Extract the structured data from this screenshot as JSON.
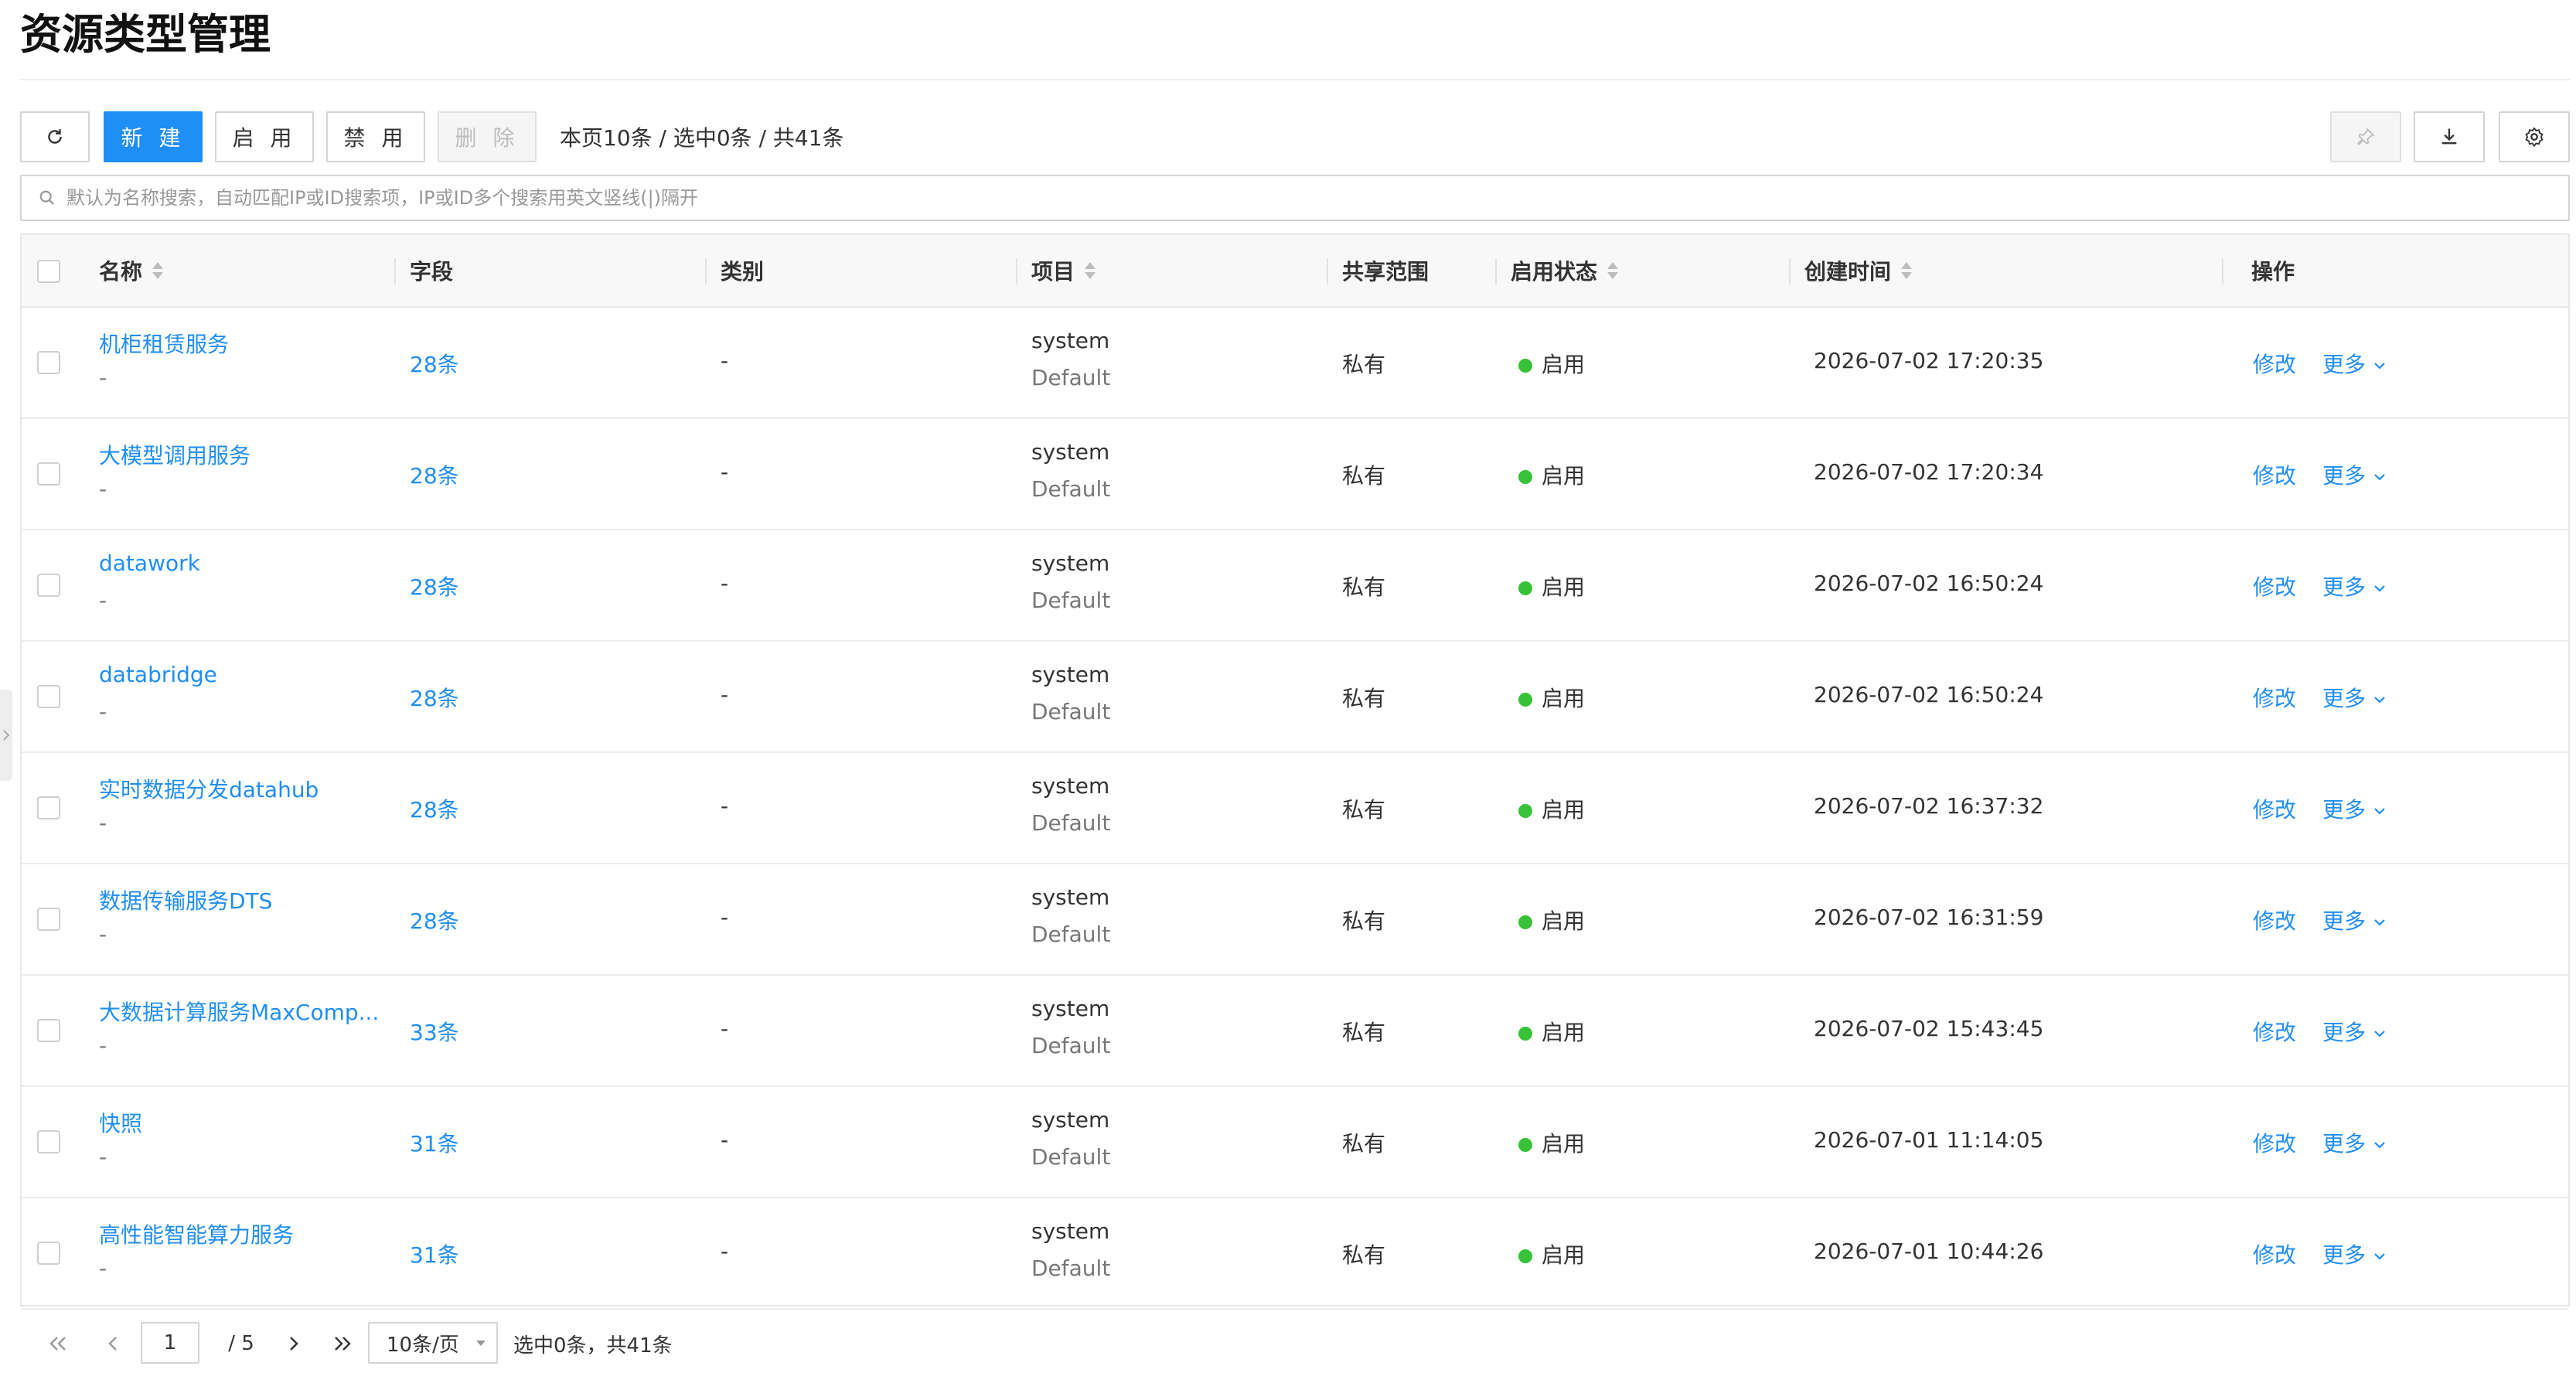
{
  "page": {
    "title": "资源类型管理"
  },
  "toolbar": {
    "new_label": "新 建",
    "enable_label": "启 用",
    "disable_label": "禁 用",
    "delete_label": "删 除",
    "summary": "本页10条 / 选中0条 / 共41条"
  },
  "search": {
    "placeholder": "默认为名称搜索，自动匹配IP或ID搜索项，IP或ID多个搜索用英文竖线(|)隔开",
    "value": ""
  },
  "table": {
    "headers": {
      "name": "名称",
      "fields": "字段",
      "category": "类别",
      "project": "项目",
      "share": "共享范围",
      "status": "启用状态",
      "created": "创建时间",
      "ops": "操作"
    },
    "rows": [
      {
        "name": "机柜租赁服务",
        "name_sub": "-",
        "fields": "28条",
        "category": "-",
        "project": "system",
        "project_sub": "Default",
        "share": "私有",
        "status": "启用",
        "created": "2026-07-02 17:20:35",
        "edit": "修改",
        "more": "更多"
      },
      {
        "name": "大模型调用服务",
        "name_sub": "-",
        "fields": "28条",
        "category": "-",
        "project": "system",
        "project_sub": "Default",
        "share": "私有",
        "status": "启用",
        "created": "2026-07-02 17:20:34",
        "edit": "修改",
        "more": "更多"
      },
      {
        "name": "datawork",
        "name_sub": "-",
        "fields": "28条",
        "category": "-",
        "project": "system",
        "project_sub": "Default",
        "share": "私有",
        "status": "启用",
        "created": "2026-07-02 16:50:24",
        "edit": "修改",
        "more": "更多"
      },
      {
        "name": "databridge",
        "name_sub": "-",
        "fields": "28条",
        "category": "-",
        "project": "system",
        "project_sub": "Default",
        "share": "私有",
        "status": "启用",
        "created": "2026-07-02 16:50:24",
        "edit": "修改",
        "more": "更多"
      },
      {
        "name": "实时数据分发datahub",
        "name_sub": "-",
        "fields": "28条",
        "category": "-",
        "project": "system",
        "project_sub": "Default",
        "share": "私有",
        "status": "启用",
        "created": "2026-07-02 16:37:32",
        "edit": "修改",
        "more": "更多"
      },
      {
        "name": "数据传输服务DTS",
        "name_sub": "-",
        "fields": "28条",
        "category": "-",
        "project": "system",
        "project_sub": "Default",
        "share": "私有",
        "status": "启用",
        "created": "2026-07-02 16:31:59",
        "edit": "修改",
        "more": "更多"
      },
      {
        "name": "大数据计算服务MaxComp...",
        "name_sub": "-",
        "fields": "33条",
        "category": "-",
        "project": "system",
        "project_sub": "Default",
        "share": "私有",
        "status": "启用",
        "created": "2026-07-02 15:43:45",
        "edit": "修改",
        "more": "更多"
      },
      {
        "name": "快照",
        "name_sub": "-",
        "fields": "31条",
        "category": "-",
        "project": "system",
        "project_sub": "Default",
        "share": "私有",
        "status": "启用",
        "created": "2026-07-01 11:14:05",
        "edit": "修改",
        "more": "更多"
      },
      {
        "name": "高性能智能算力服务",
        "name_sub": "-",
        "fields": "31条",
        "category": "-",
        "project": "system",
        "project_sub": "Default",
        "share": "私有",
        "status": "启用",
        "created": "2026-07-01 10:44:26",
        "edit": "修改",
        "more": "更多"
      }
    ]
  },
  "pagination": {
    "current_page": "1",
    "total_pages": "/ 5",
    "page_size": "10条/页",
    "summary": "选中0条，共41条"
  },
  "colors": {
    "primary": "#1f8ef5",
    "status_enabled": "#38c237"
  }
}
